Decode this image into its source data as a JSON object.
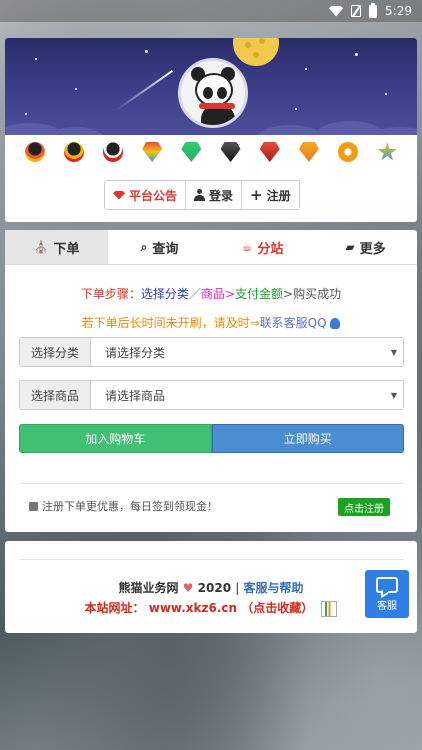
{
  "statusbar": {
    "time": "5:29"
  },
  "header": {
    "nav": {
      "notice": "平台公告",
      "login": "登录",
      "register": "注册"
    },
    "icons": [
      "qq-penguin-icon",
      "qq-penguin-icon",
      "qq-penguin-icon",
      "diamond-icon",
      "diamond-icon",
      "diamond-icon",
      "diamond-icon",
      "diamond-icon",
      "swirl-icon",
      "star-icon"
    ]
  },
  "tabs": [
    {
      "label": "下单",
      "icon": "bag-icon"
    },
    {
      "label": "查询",
      "icon": "search-icon"
    },
    {
      "label": "分站",
      "icon": "cup-icon"
    },
    {
      "label": "更多",
      "icon": "folder-icon"
    }
  ],
  "steps": {
    "prefix": "下单步骤：",
    "s1": "选择分类",
    "sep1": "／",
    "s2": "商品",
    "sep2": ">",
    "s3": "支付金额",
    "sep3": ">",
    "s4": "购买成功"
  },
  "hint": {
    "text": "若下单后长时间未开刷，请及时",
    "sep": "⇒",
    "contact": "联系客服QQ"
  },
  "form": {
    "category": {
      "label": "选择分类",
      "placeholder": "请选择分类"
    },
    "product": {
      "label": "选择商品",
      "placeholder": "请选择商品"
    }
  },
  "actions": {
    "add_cart": "加入购物车",
    "buy_now": "立即购买"
  },
  "promo": {
    "text": "注册下单更优惠，每日签到领现金！",
    "button": "点击注册"
  },
  "footer": {
    "site": "熊猫业务网",
    "year": "2020",
    "sep": "|",
    "help": "客服与帮助",
    "url_label": "本站网址：",
    "url": "www.xkz6.cn",
    "bookmark": "（点击收藏）",
    "kefu": "客服"
  },
  "colors": {
    "accent_red": "#e0362c",
    "green": "#3fc073",
    "blue": "#4a8ed1",
    "kefu_blue": "#2f7fe4"
  }
}
